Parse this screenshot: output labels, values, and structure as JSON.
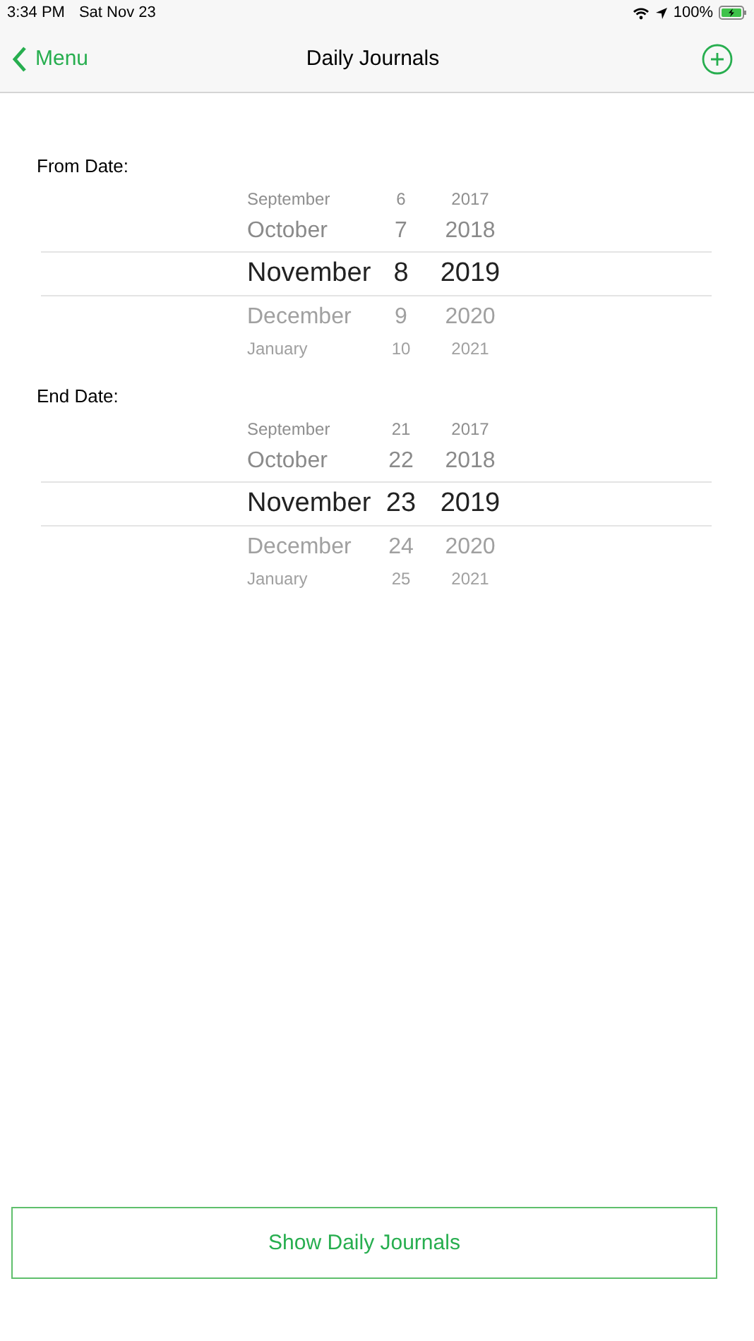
{
  "status_bar": {
    "time": "3:34 PM",
    "date": "Sat Nov 23",
    "battery": "100%"
  },
  "nav": {
    "back": "Menu",
    "title": "Daily Journals"
  },
  "pickers": [
    {
      "label": "From Date:",
      "rows": [
        {
          "month": "September",
          "day": "6",
          "year": "2017",
          "selected": false
        },
        {
          "month": "October",
          "day": "7",
          "year": "2018",
          "selected": false
        },
        {
          "month": "November",
          "day": "8",
          "year": "2019",
          "selected": true
        },
        {
          "month": "December",
          "day": "9",
          "year": "2020",
          "selected": false
        },
        {
          "month": "January",
          "day": "10",
          "year": "2021",
          "selected": false
        }
      ]
    },
    {
      "label": "End Date:",
      "rows": [
        {
          "month": "September",
          "day": "21",
          "year": "2017",
          "selected": false
        },
        {
          "month": "October",
          "day": "22",
          "year": "2018",
          "selected": false
        },
        {
          "month": "November",
          "day": "23",
          "year": "2019",
          "selected": true
        },
        {
          "month": "December",
          "day": "24",
          "year": "2020",
          "selected": false
        },
        {
          "month": "January",
          "day": "25",
          "year": "2021",
          "selected": false
        }
      ]
    }
  ],
  "button": "Show Daily Journals"
}
